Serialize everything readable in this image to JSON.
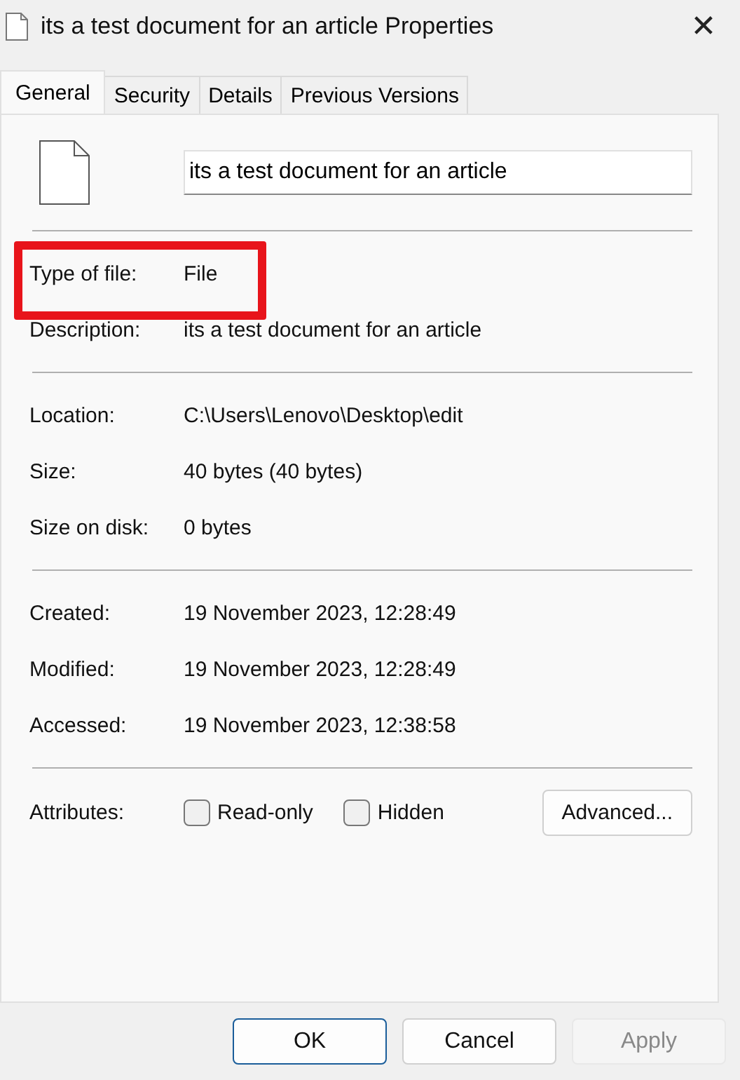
{
  "window": {
    "title": "its a test document for an article Properties",
    "close": "✕"
  },
  "tabs": [
    {
      "label": "General",
      "selected": true
    },
    {
      "label": "Security",
      "selected": false
    },
    {
      "label": "Details",
      "selected": false
    },
    {
      "label": "Previous Versions",
      "selected": false
    }
  ],
  "name_field": {
    "value": "its a test document for an article"
  },
  "groups": [
    [
      {
        "label": "Type of file:",
        "value": "File",
        "highlighted": true
      },
      {
        "label": "Description:",
        "value": "its a test document for an article",
        "highlighted": false
      }
    ],
    [
      {
        "label": "Location:",
        "value": "C:\\Users\\Lenovo\\Desktop\\edit",
        "highlighted": false
      },
      {
        "label": "Size:",
        "value": "40 bytes (40 bytes)",
        "highlighted": false
      },
      {
        "label": "Size on disk:",
        "value": "0 bytes",
        "highlighted": false
      }
    ],
    [
      {
        "label": "Created:",
        "value": "19 November 2023, 12:28:49",
        "highlighted": false
      },
      {
        "label": "Modified:",
        "value": "19 November 2023, 12:28:49",
        "highlighted": false
      },
      {
        "label": "Accessed:",
        "value": "19 November 2023, 12:38:58",
        "highlighted": false
      }
    ]
  ],
  "attributes": {
    "label": "Attributes:",
    "checkboxes": [
      {
        "label": "Read-only",
        "checked": false
      },
      {
        "label": "Hidden",
        "checked": false
      }
    ],
    "button": "Advanced..."
  },
  "buttons": [
    {
      "label": "OK",
      "default": true,
      "disabled": false
    },
    {
      "label": "Cancel",
      "default": false,
      "disabled": false
    },
    {
      "label": "Apply",
      "default": false,
      "disabled": true
    }
  ]
}
